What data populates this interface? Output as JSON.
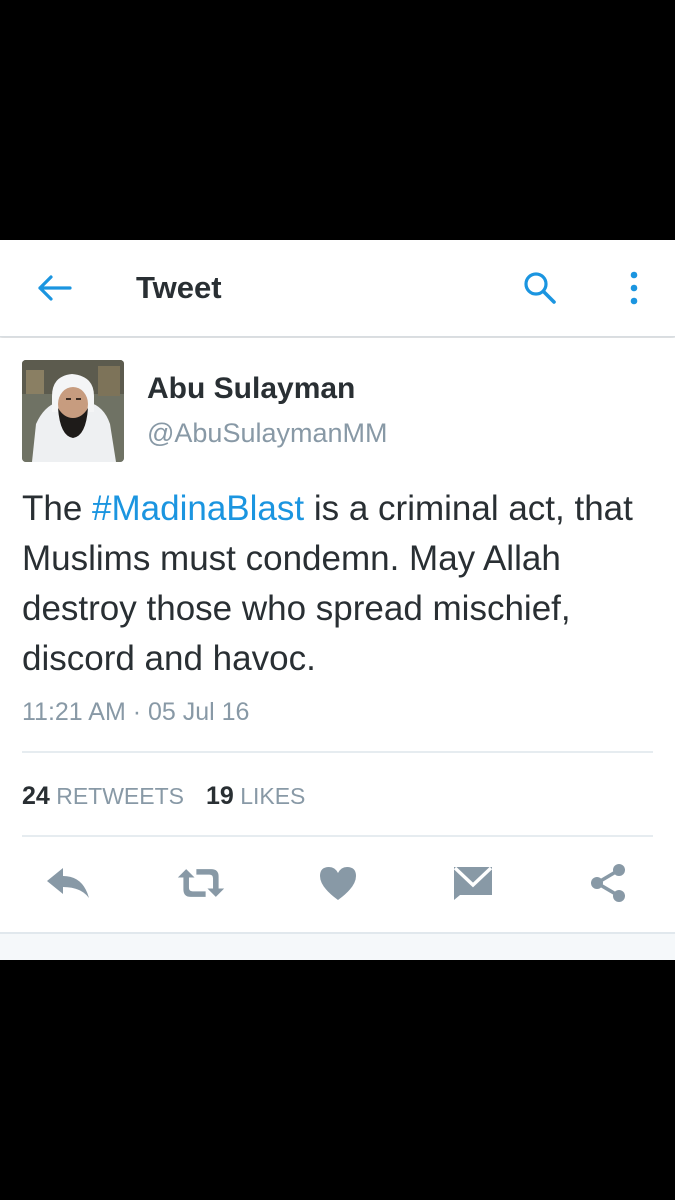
{
  "appbar": {
    "title": "Tweet",
    "back_icon": "arrow-left-icon",
    "search_icon": "search-icon",
    "more_icon": "more-vertical-icon",
    "accent_color": "#1b95e0"
  },
  "tweet": {
    "author_name": "Abu Sulayman",
    "author_handle": "@AbuSulaymanMM",
    "text_before": "The ",
    "hashtag": "#MadinaBlast",
    "text_after": " is a criminal act, that Muslims must condemn. May Allah destroy those who spread mischief, discord and havoc.",
    "timestamp": "11:21 AM · 05 Jul 16"
  },
  "stats": {
    "retweets_count": "24",
    "retweets_label": "RETWEETS",
    "likes_count": "19",
    "likes_label": "LIKES"
  },
  "actions": {
    "icons": [
      "reply-icon",
      "retweet-icon",
      "heart-icon",
      "message-icon",
      "share-icon"
    ],
    "icon_color": "#8899a6"
  }
}
